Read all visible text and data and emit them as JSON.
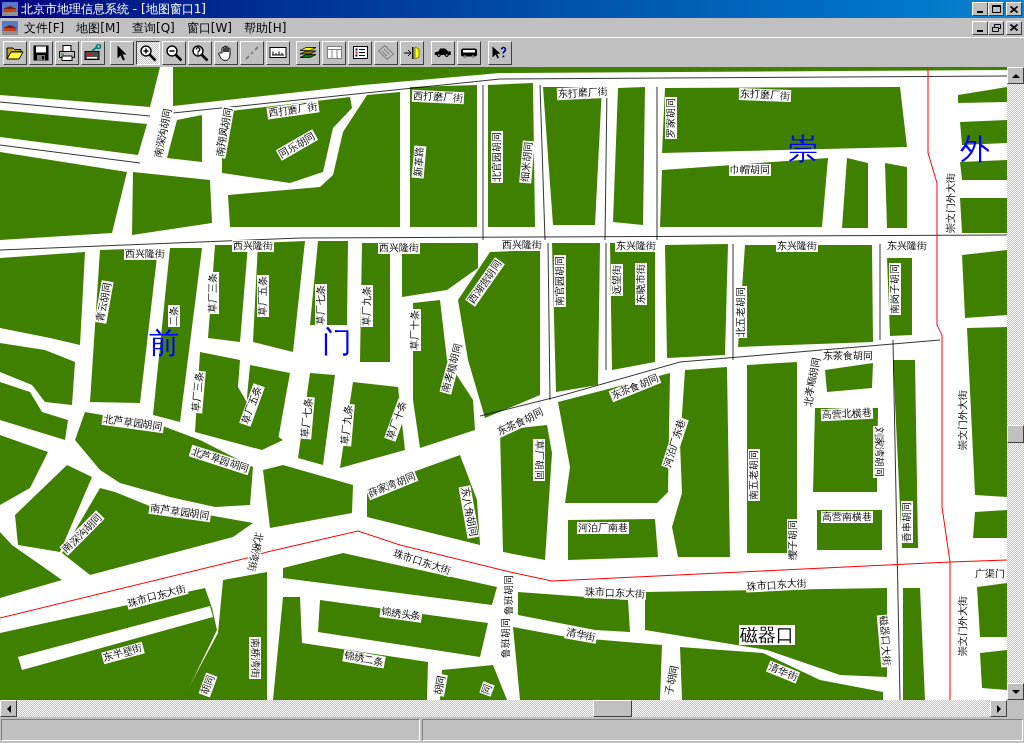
{
  "window": {
    "title": "北京市地理信息系统 - [地图窗口1]"
  },
  "menu": [
    {
      "label": "文件[F]"
    },
    {
      "label": "地图[M]"
    },
    {
      "label": "查询[Q]"
    },
    {
      "label": "窗口[W]"
    },
    {
      "label": "帮助[H]"
    }
  ],
  "toolbar": [
    {
      "selected": false,
      "disabled": false
    },
    {
      "selected": false,
      "disabled": false
    },
    {
      "selected": false,
      "disabled": false
    },
    {
      "selected": false,
      "disabled": false
    },
    {
      "selected": false,
      "disabled": false
    },
    {
      "selected": true,
      "disabled": false
    },
    {
      "selected": false,
      "disabled": false
    },
    {
      "selected": false,
      "disabled": false
    },
    {
      "selected": false,
      "disabled": false
    },
    {
      "selected": false,
      "disabled": true
    },
    {
      "selected": false,
      "disabled": false
    },
    {
      "selected": false,
      "disabled": false
    },
    {
      "selected": false,
      "disabled": true
    },
    {
      "selected": false,
      "disabled": false
    },
    {
      "selected": false,
      "disabled": true
    },
    {
      "selected": false,
      "disabled": false
    },
    {
      "selected": false,
      "disabled": false
    },
    {
      "selected": false,
      "disabled": false
    },
    {
      "selected": false,
      "disabled": false
    }
  ],
  "map": {
    "labels": [
      {
        "kind": "street",
        "text": "西打磨厂街"
      },
      {
        "kind": "street",
        "text": "西打磨厂街"
      },
      {
        "kind": "street",
        "text": "东打磨厂街"
      },
      {
        "kind": "street",
        "text": "东打磨厂街"
      },
      {
        "kind": "street",
        "text": "罗家胡同"
      },
      {
        "kind": "street",
        "text": "南深沟胡同"
      },
      {
        "kind": "street",
        "text": "南翔凤胡同"
      },
      {
        "kind": "street",
        "text": "同乐胡同"
      },
      {
        "kind": "district",
        "text": "崇"
      },
      {
        "kind": "district",
        "text": "外"
      },
      {
        "kind": "street",
        "text": "新革路"
      },
      {
        "kind": "street",
        "text": "北官园胡同"
      },
      {
        "kind": "street",
        "text": "细米胡同"
      },
      {
        "kind": "street",
        "text": "巾帽胡同"
      },
      {
        "kind": "street",
        "text": "崇文门外大街"
      },
      {
        "kind": "street",
        "text": "西兴隆街"
      },
      {
        "kind": "street",
        "text": "西兴隆街"
      },
      {
        "kind": "street",
        "text": "西兴隆街"
      },
      {
        "kind": "street",
        "text": "西兴隆街"
      },
      {
        "kind": "street",
        "text": "东兴隆街"
      },
      {
        "kind": "street",
        "text": "东兴隆街"
      },
      {
        "kind": "street",
        "text": "东兴隆街"
      },
      {
        "kind": "street",
        "text": "西湖营胡同"
      },
      {
        "kind": "street",
        "text": "南官园胡同"
      },
      {
        "kind": "street",
        "text": "远望街"
      },
      {
        "kind": "street",
        "text": "东晓市街"
      },
      {
        "kind": "street",
        "text": "南岗子胡同"
      },
      {
        "kind": "street",
        "text": "青云胡同"
      },
      {
        "kind": "street",
        "text": "草厂三条"
      },
      {
        "kind": "street",
        "text": "草厂五条"
      },
      {
        "kind": "street",
        "text": "草厂七条"
      },
      {
        "kind": "street",
        "text": "草厂九条"
      },
      {
        "kind": "street",
        "text": "北五老胡同"
      },
      {
        "kind": "street",
        "text": "二条"
      },
      {
        "kind": "street",
        "text": "草厂十条"
      },
      {
        "kind": "district",
        "text": "前"
      },
      {
        "kind": "district",
        "text": "门"
      },
      {
        "kind": "street",
        "text": "东茶食胡同"
      },
      {
        "kind": "street",
        "text": "北孝顺胡同"
      },
      {
        "kind": "street",
        "text": "南孝顺胡同"
      },
      {
        "kind": "street",
        "text": "东茶食胡同"
      },
      {
        "kind": "street",
        "text": "草厂三条"
      },
      {
        "kind": "street",
        "text": "草厂五条"
      },
      {
        "kind": "street",
        "text": "草厂七条"
      },
      {
        "kind": "street",
        "text": "草厂九条"
      },
      {
        "kind": "street",
        "text": "草厂十条"
      },
      {
        "kind": "street",
        "text": "高营北横巷"
      },
      {
        "kind": "street",
        "text": "崇文门外大街"
      },
      {
        "kind": "street",
        "text": "北芦草园胡同"
      },
      {
        "kind": "street",
        "text": "东茶食胡同"
      },
      {
        "kind": "street",
        "text": "河泊厂东巷"
      },
      {
        "kind": "street",
        "text": "刘家湾胡同"
      },
      {
        "kind": "street",
        "text": "草厂胡同"
      },
      {
        "kind": "street",
        "text": "北芦草园胡同"
      },
      {
        "kind": "street",
        "text": "南五老胡同"
      },
      {
        "kind": "street",
        "text": "薛家湾胡同"
      },
      {
        "kind": "street",
        "text": "东八角胡同"
      },
      {
        "kind": "street",
        "text": "南芦草园胡同"
      },
      {
        "kind": "street",
        "text": "高营南横巷"
      },
      {
        "kind": "street",
        "text": "香串胡同"
      },
      {
        "kind": "street",
        "text": "河泊厂南巷"
      },
      {
        "kind": "street",
        "text": "南深沟胡同"
      },
      {
        "kind": "street",
        "text": "缨子胡同"
      },
      {
        "kind": "street",
        "text": "北桥湾街"
      },
      {
        "kind": "street",
        "text": "珠市口东大街"
      },
      {
        "kind": "street",
        "text": "广渠门"
      },
      {
        "kind": "street",
        "text": "珠市口东大街"
      },
      {
        "kind": "street",
        "text": "珠市口东大街"
      },
      {
        "kind": "street",
        "text": "珠市口东大街"
      },
      {
        "kind": "street",
        "text": "鲁班胡同"
      },
      {
        "kind": "street",
        "text": "锦绣头条"
      },
      {
        "kind": "street",
        "text": "鲁班胡同"
      },
      {
        "kind": "street",
        "text": "崇文门外大街"
      },
      {
        "kind": "street",
        "text": "清华街"
      },
      {
        "kind": "place",
        "text": "磁器口"
      },
      {
        "kind": "street",
        "text": "磁器口大街"
      },
      {
        "kind": "street",
        "text": "东半壁街"
      },
      {
        "kind": "street",
        "text": "南桥湾街"
      },
      {
        "kind": "street",
        "text": "锦绣二条"
      },
      {
        "kind": "street",
        "text": "清华街"
      },
      {
        "kind": "street",
        "text": "胡同"
      },
      {
        "kind": "street",
        "text": "胡同"
      },
      {
        "kind": "street",
        "text": "同"
      },
      {
        "kind": "street",
        "text": "子胡同"
      }
    ]
  }
}
